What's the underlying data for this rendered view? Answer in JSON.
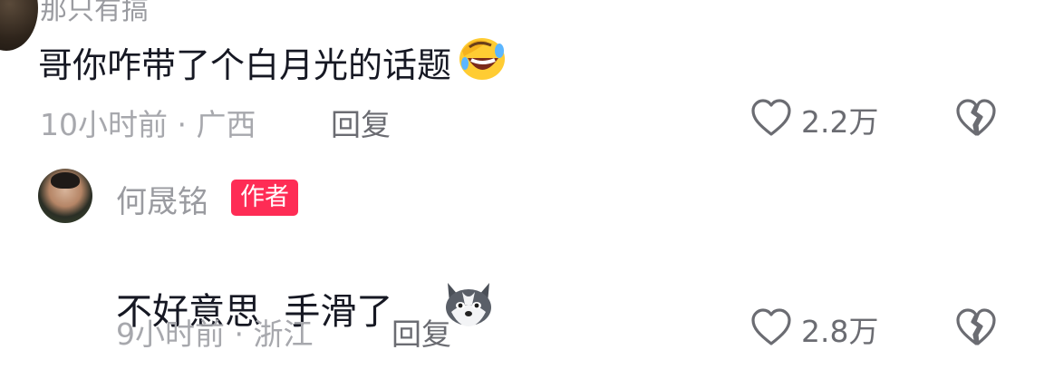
{
  "top_comment": {
    "username": "那只有搞",
    "text": "哥你咋带了个白月光的话题",
    "emoji": "laughing-face-icon",
    "time": "10小时前",
    "location": "广西",
    "reply_label": "回复",
    "likes": "2.2万"
  },
  "author_reply": {
    "username": "何晟铭",
    "badge": "作者",
    "text": "不好意思  手滑了",
    "emoji": "husky-dog-icon",
    "time": "9小时前",
    "location": "浙江",
    "reply_label": "回复",
    "likes": "2.8万"
  },
  "colors": {
    "badge": "#fe2c55",
    "meta": "#a7a8ad",
    "action": "#6b6c72"
  }
}
